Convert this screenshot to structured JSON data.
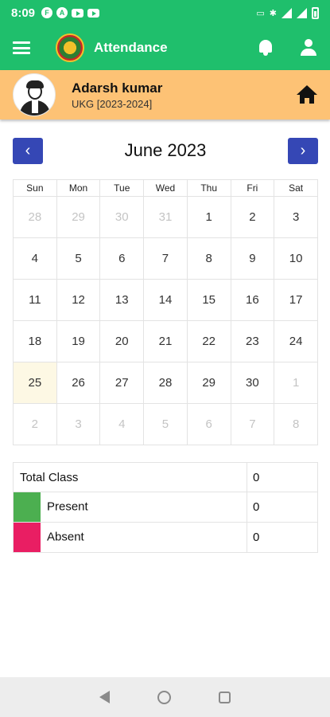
{
  "status_bar": {
    "time": "8:09",
    "icons": [
      "f-app-icon",
      "a-app-icon",
      "youtube-icon",
      "youtube-icon",
      "volte-icon",
      "bluetooth-icon",
      "signal-icon",
      "battery-icon"
    ]
  },
  "app_bar": {
    "title": "Attendance",
    "icons": [
      "menu-icon",
      "school-logo",
      "bell-icon",
      "person-icon"
    ]
  },
  "profile": {
    "name": "Adarsh kumar",
    "class_info": "UKG [2023-2024]"
  },
  "calendar": {
    "month_title": "June 2023",
    "prev_label": "‹",
    "next_label": "›",
    "weekdays": [
      "Sun",
      "Mon",
      "Tue",
      "Wed",
      "Thu",
      "Fri",
      "Sat"
    ],
    "weeks": [
      [
        "28",
        "29",
        "30",
        "31",
        "1",
        "2",
        "3"
      ],
      [
        "4",
        "5",
        "6",
        "7",
        "8",
        "9",
        "10"
      ],
      [
        "11",
        "12",
        "13",
        "14",
        "15",
        "16",
        "17"
      ],
      [
        "18",
        "19",
        "20",
        "21",
        "22",
        "23",
        "24"
      ],
      [
        "25",
        "26",
        "27",
        "28",
        "29",
        "30",
        "1"
      ],
      [
        "2",
        "3",
        "4",
        "5",
        "6",
        "7",
        "8"
      ]
    ],
    "highlighted_day": "25"
  },
  "summary": {
    "total_label": "Total Class",
    "total_value": "0",
    "present_label": "Present",
    "present_value": "0",
    "present_color": "#4caf50",
    "absent_label": "Absent",
    "absent_value": "0",
    "absent_color": "#e91e63"
  },
  "colors": {
    "header_green": "#1fbf6c",
    "profile_bg": "#fdc275",
    "nav_button": "#3547b5",
    "today_bg": "#fdf8e4"
  }
}
